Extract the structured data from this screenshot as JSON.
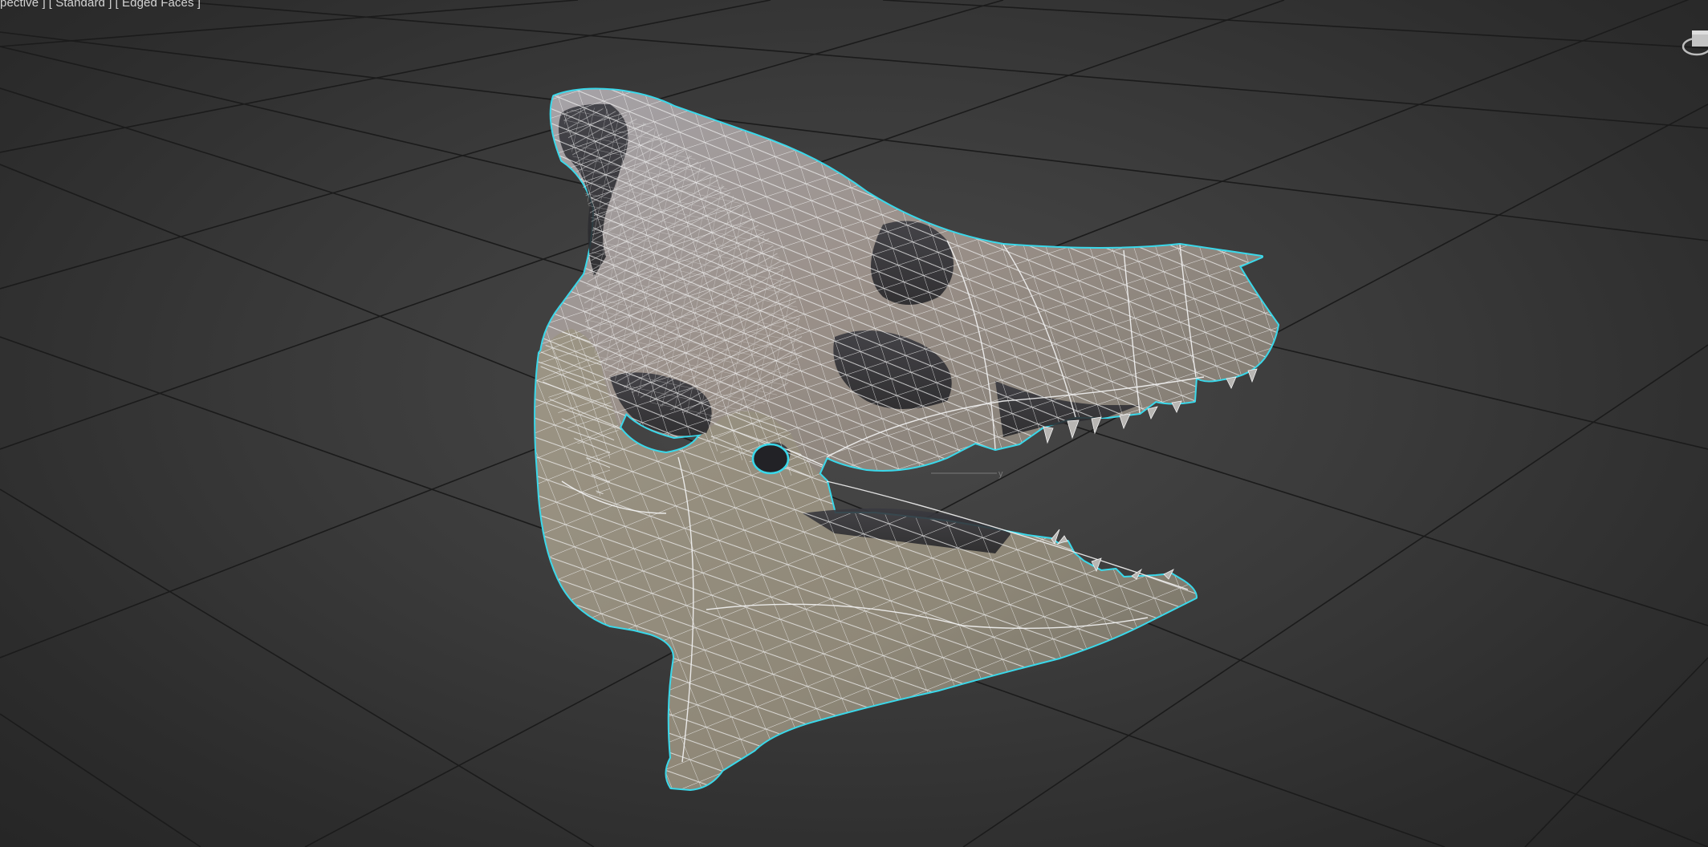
{
  "viewport": {
    "labels": [
      "pective ]",
      "[ Standard ]",
      "[ Edged Faces ]"
    ],
    "axis_label": "y",
    "background_color": "#3a3a3a",
    "grid_color": "#1c1c1c",
    "selection_outline_color": "#3ad8ea",
    "wire_color": "#f2f2f2"
  },
  "scene_object": {
    "icon": "skull-mesh",
    "state": "selected"
  },
  "viewcube": {
    "icon": "viewcube-icon"
  }
}
